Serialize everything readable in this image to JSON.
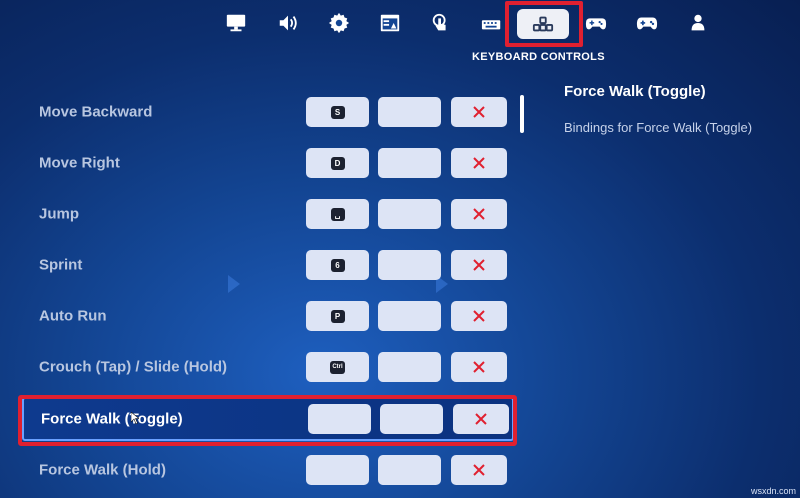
{
  "tabs": [
    {
      "id": "video",
      "icon": "monitor-icon"
    },
    {
      "id": "audio",
      "icon": "speaker-icon"
    },
    {
      "id": "game",
      "icon": "gear-icon"
    },
    {
      "id": "accessibility",
      "icon": "window-icon"
    },
    {
      "id": "touch",
      "icon": "touch-hand-icon"
    },
    {
      "id": "mouse-keyboard",
      "icon": "keyboard-icon"
    },
    {
      "id": "keyboard-controls",
      "icon": "keyboard-controls-icon",
      "active": true
    },
    {
      "id": "controller",
      "icon": "controller-icon"
    },
    {
      "id": "gamepad",
      "icon": "gamepad-icon"
    },
    {
      "id": "account",
      "icon": "user-icon"
    }
  ],
  "active_tab_caption": "KEYBOARD CONTROLS",
  "bindings": [
    {
      "action": "Move Backward",
      "key": "S",
      "secondary": ""
    },
    {
      "action": "Move Right",
      "key": "D",
      "secondary": ""
    },
    {
      "action": "Jump",
      "key": "␣",
      "secondary": ""
    },
    {
      "action": "Sprint",
      "key": "6",
      "secondary": ""
    },
    {
      "action": "Auto Run",
      "key": "P",
      "secondary": ""
    },
    {
      "action": "Crouch (Tap) / Slide (Hold)",
      "key": "Ctrl",
      "secondary": ""
    },
    {
      "action": "Force Walk (Toggle)",
      "key": "",
      "secondary": "",
      "selected": true
    },
    {
      "action": "Force Walk (Hold)",
      "key": "",
      "secondary": ""
    }
  ],
  "clear_icon": "x-icon",
  "detail": {
    "title": "Force Walk (Toggle)",
    "description": "Bindings for Force Walk (Toggle)"
  },
  "watermark": "wsxdn.com",
  "colors": {
    "highlight": "#e02030",
    "background": "#134593",
    "slot": "#dde4f5"
  }
}
